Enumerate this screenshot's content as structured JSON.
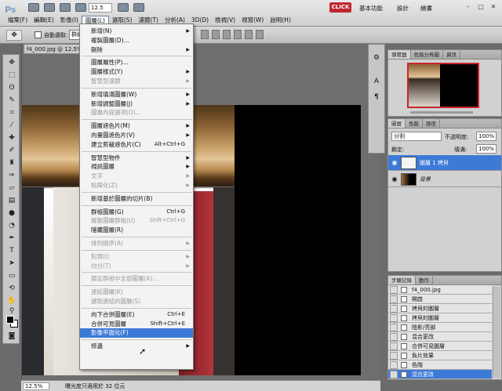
{
  "app": {
    "logo": "Ps",
    "zoom": "12.5",
    "click_button": "CLICK",
    "workspace_basic": "基本功能",
    "workspace_design": "設計",
    "workspace_paint": "繪畫",
    "win_min": "–",
    "win_max": "□",
    "win_close": "✕"
  },
  "menu": {
    "items": [
      "檔案(F)",
      "編輯(E)",
      "影像(I)",
      "圖層(L)",
      "選取(S)",
      "濾鏡(T)",
      "分析(A)",
      "3D(D)",
      "檢視(V)",
      "視窗(W)",
      "說明(H)"
    ]
  },
  "options": {
    "tool_icon": "✥",
    "auto_select": "自動選取:",
    "auto_select_value": "群組"
  },
  "document": {
    "tab_title": "f4_000.jpg @ 12.5% ("
  },
  "status": {
    "zoom": "12.5%",
    "text": "曝光度只適用於 32 位元"
  },
  "dropdown": {
    "items": [
      {
        "label": "新增(N)",
        "arrow": true,
        "disabled": false
      },
      {
        "label": "複製圖層(D)...",
        "disabled": false
      },
      {
        "label": "刪除",
        "arrow": true,
        "disabled": false
      },
      {
        "sep": true
      },
      {
        "label": "圖層屬性(P)...",
        "disabled": false
      },
      {
        "label": "圖層樣式(Y)",
        "arrow": true,
        "disabled": false
      },
      {
        "label": "智慧型濾鏡",
        "arrow": true,
        "disabled": true
      },
      {
        "sep": true
      },
      {
        "label": "新增填滿圖層(W)",
        "arrow": true,
        "disabled": false
      },
      {
        "label": "新增調整圖層(J)",
        "arrow": true,
        "disabled": false
      },
      {
        "label": "圖層內容選項(O)...",
        "disabled": true
      },
      {
        "sep": true
      },
      {
        "label": "圖層遮色片(M)",
        "arrow": true,
        "disabled": false
      },
      {
        "label": "向量圖遮色片(V)",
        "arrow": true,
        "disabled": false
      },
      {
        "label": "建立剪裁遮色片(C)",
        "shortcut": "Alt+Ctrl+G",
        "disabled": false
      },
      {
        "sep": true
      },
      {
        "label": "智慧型物件",
        "arrow": true,
        "disabled": false
      },
      {
        "label": "視訊圖層",
        "arrow": true,
        "disabled": false
      },
      {
        "label": "文字",
        "arrow": true,
        "disabled": true
      },
      {
        "label": "點陣化(Z)",
        "arrow": true,
        "disabled": true
      },
      {
        "sep": true
      },
      {
        "label": "新增基於圖層的切片(B)",
        "disabled": false
      },
      {
        "sep": true
      },
      {
        "label": "群組圖層(G)",
        "shortcut": "Ctrl+G",
        "disabled": false
      },
      {
        "label": "解散圖層群組(U)",
        "shortcut": "Shift+Ctrl+G",
        "disabled": true
      },
      {
        "label": "隱藏圖層(R)",
        "disabled": false
      },
      {
        "sep": true
      },
      {
        "label": "排列順序(A)",
        "arrow": true,
        "disabled": true
      },
      {
        "sep": true
      },
      {
        "label": "對齊(I)",
        "arrow": true,
        "disabled": true
      },
      {
        "label": "均分(T)",
        "arrow": true,
        "disabled": true
      },
      {
        "sep": true
      },
      {
        "label": "鎖定群組中全部圖層(X)...",
        "disabled": true
      },
      {
        "sep": true
      },
      {
        "label": "連結圖層(K)",
        "disabled": true
      },
      {
        "label": "選取連結的圖層(S)",
        "disabled": true
      },
      {
        "sep": true
      },
      {
        "label": "向下合併圖層(E)",
        "shortcut": "Ctrl+E",
        "disabled": false
      },
      {
        "label": "合併可見圖層",
        "shortcut": "Shift+Ctrl+E",
        "disabled": false
      },
      {
        "label": "影像平面化(F)",
        "disabled": false,
        "highlighted": true
      },
      {
        "sep": true
      },
      {
        "label": "修邊",
        "arrow": true,
        "disabled": false
      }
    ]
  },
  "panels": {
    "navigator_tabs": [
      "導覽器",
      "色階分佈圖",
      "資訊"
    ],
    "layers_tabs": [
      "圖層",
      "色版",
      "路徑"
    ],
    "blend_mode": "分割",
    "opacity_label": "不透明度:",
    "opacity_value": "100%",
    "lock_label": "鎖定:",
    "fill_label": "填滿:",
    "fill_value": "100%",
    "layers": [
      {
        "name": "圖層 1 拷貝",
        "selected": true
      },
      {
        "name": "背景",
        "selected": false
      }
    ],
    "history_tabs": [
      "步驟記錄",
      "動作"
    ],
    "history": [
      "f4_000.jpg",
      "開啟",
      "拷貝的圖層",
      "拷貝的圖層",
      "陰影/亮部",
      "混合更改",
      "合併可見圖層",
      "負片效果",
      "色階",
      "混合更改"
    ]
  }
}
